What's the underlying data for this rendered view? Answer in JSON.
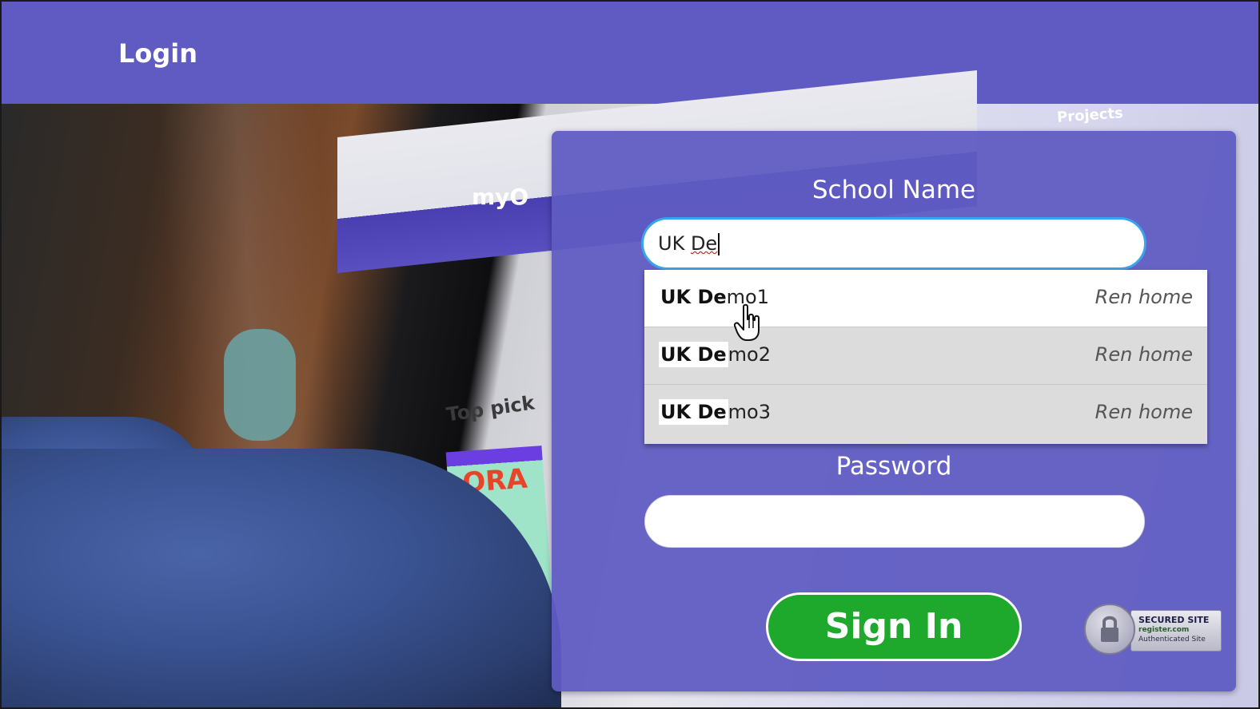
{
  "header": {
    "title": "Login"
  },
  "background": {
    "logo_text": "myO",
    "top_picks": "Top pick",
    "book_title": "ORA",
    "projects": "Projects"
  },
  "form": {
    "school_label": "School Name",
    "school_value_plain": "UK ",
    "school_value_misspelled": "De",
    "password_label": "Password",
    "password_value": "",
    "sign_in_label": "Sign In"
  },
  "suggestions": [
    {
      "match": "UK De",
      "rest": "mo1",
      "meta": "Ren home",
      "active": true
    },
    {
      "match": "UK De",
      "rest": "mo2",
      "meta": "Ren home",
      "active": false
    },
    {
      "match": "UK De",
      "rest": "mo3",
      "meta": "Ren home",
      "active": false
    }
  ],
  "seal": {
    "title": "SECURED SITE",
    "line1": "register.com",
    "line2": "Authenticated Site"
  },
  "colors": {
    "header": "#5f5bc2",
    "panel": "#5f5bc2",
    "input_focus_border": "#3aa3ee",
    "sign_in": "#1ea82c"
  }
}
